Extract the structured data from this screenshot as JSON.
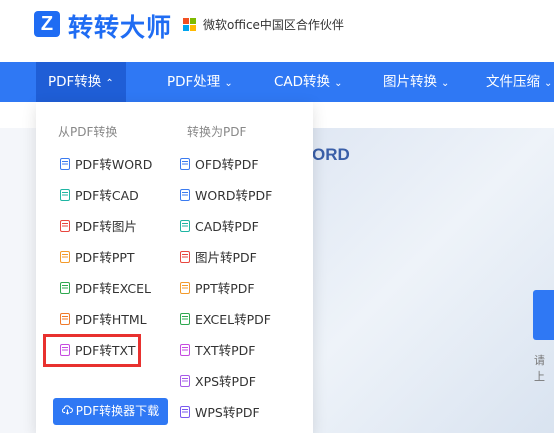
{
  "brand": {
    "logo_mark": "Z",
    "name": "转转大师",
    "partner_text": "微软office中国区合作伙伴"
  },
  "nav": {
    "items": [
      {
        "label": "PDF转换",
        "caret": "⌃"
      },
      {
        "label": "PDF处理",
        "caret": "⌄"
      },
      {
        "label": "CAD转换",
        "caret": "⌄"
      },
      {
        "label": "图片转换",
        "caret": "⌄"
      },
      {
        "label": "文件压缩",
        "caret": "⌄"
      }
    ]
  },
  "dropdown": {
    "from_pdf": {
      "heading": "从PDF转换",
      "items": [
        "PDF转WORD",
        "PDF转CAD",
        "PDF转图片",
        "PDF转PPT",
        "PDF转EXCEL",
        "PDF转HTML",
        "PDF转TXT"
      ]
    },
    "to_pdf": {
      "heading": "转换为PDF",
      "items": [
        "OFD转PDF",
        "WORD转PDF",
        "CAD转PDF",
        "图片转PDF",
        "PPT转PDF",
        "EXCEL转PDF",
        "TXT转PDF",
        "XPS转PDF",
        "WPS转PDF"
      ]
    },
    "download_button": "PDF转换器下载"
  },
  "background": {
    "title_fragment": "ORD",
    "hint_fragment": "请上"
  },
  "colors": {
    "brand_blue": "#2f78f4",
    "highlight_red": "#e8312f",
    "icon_colors_left": [
      "#3b7bf0",
      "#1fb5a3",
      "#e8473f",
      "#f39a2b",
      "#2ea84f",
      "#f07a2a",
      "#c64be0"
    ],
    "icon_colors_right": [
      "#3b7bf0",
      "#3b7bf0",
      "#1fb5a3",
      "#e8473f",
      "#f39a2b",
      "#2ea84f",
      "#c64be0",
      "#a65be8",
      "#7a5af0"
    ]
  }
}
